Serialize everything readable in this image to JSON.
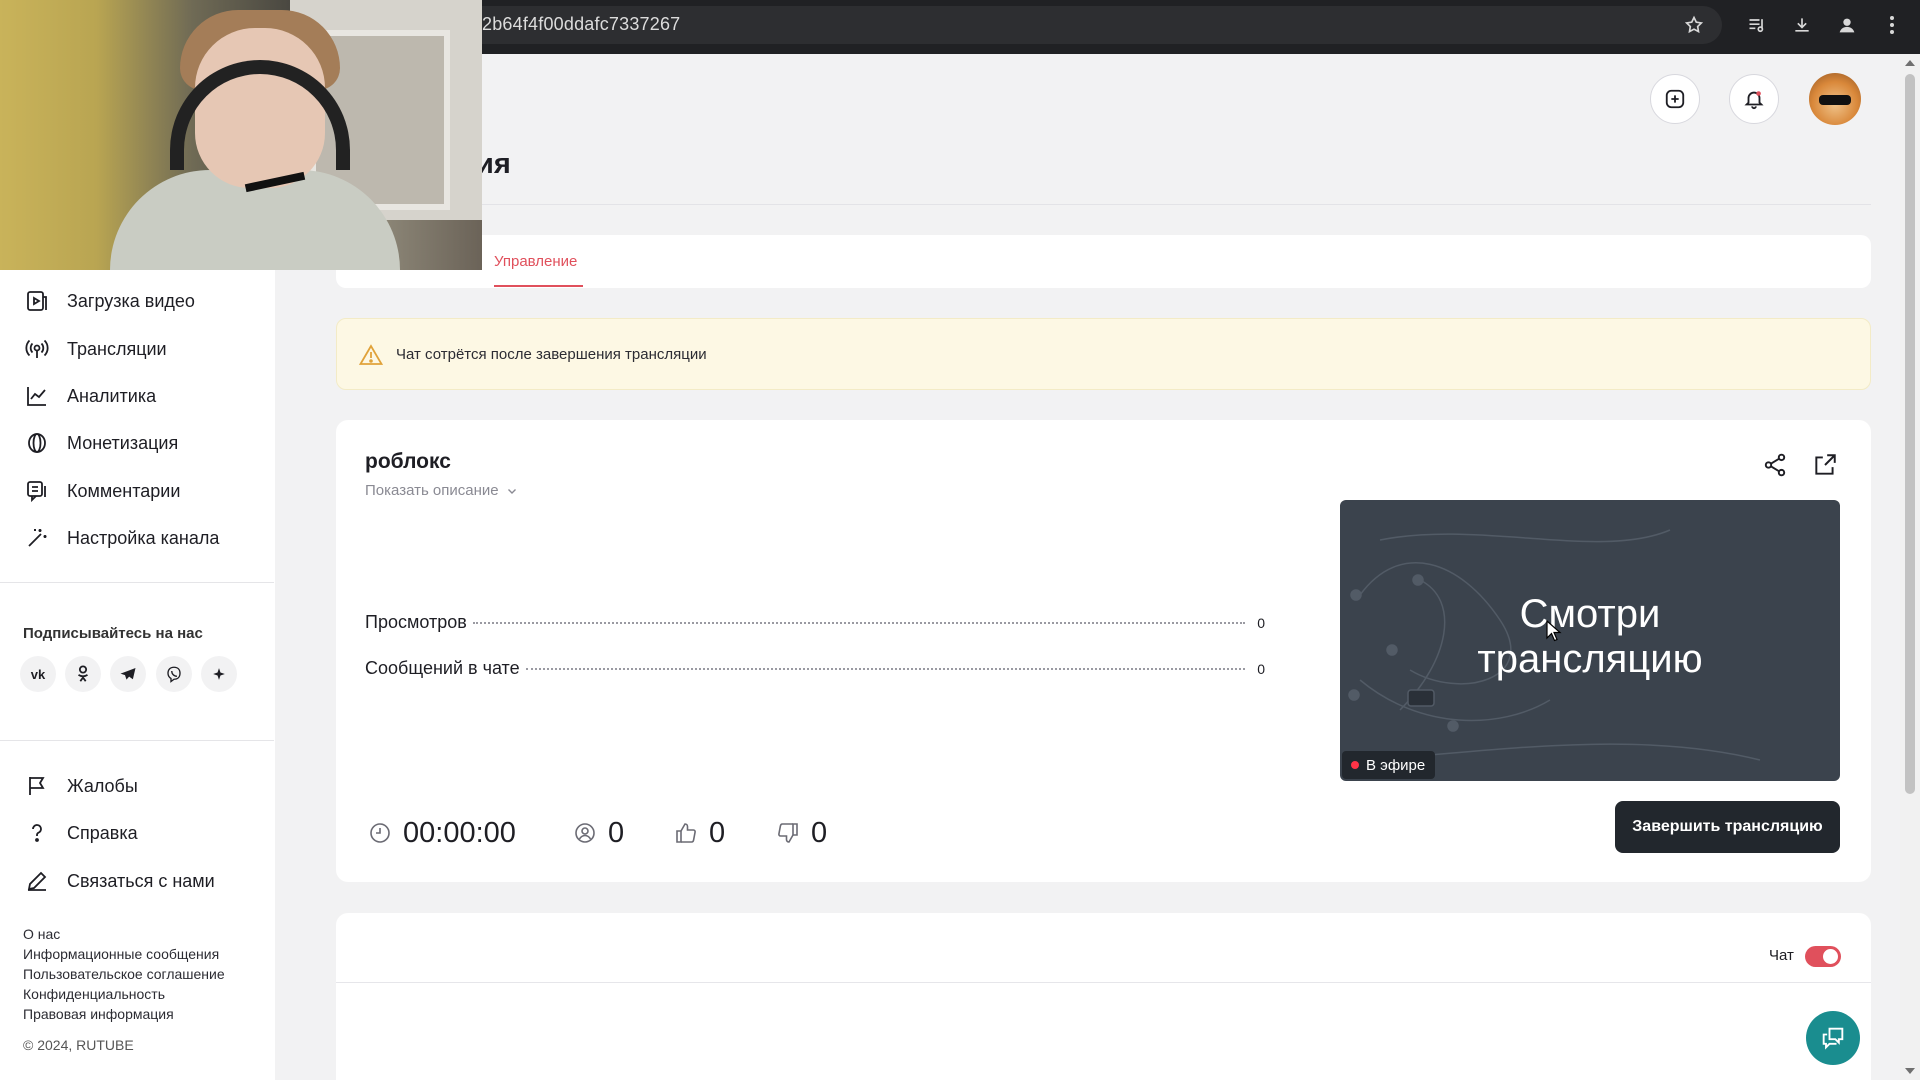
{
  "browser": {
    "url_fragment": "2b64f4f00ddafc7337267"
  },
  "header": {
    "page_title_visible": "ия"
  },
  "tabs": {
    "active": "Управление"
  },
  "sidebar": {
    "items": [
      {
        "label": "Загрузка видео",
        "icon": "video-upload-icon"
      },
      {
        "label": "Трансляции",
        "icon": "broadcast-icon"
      },
      {
        "label": "Аналитика",
        "icon": "analytics-icon"
      },
      {
        "label": "Монетизация",
        "icon": "coin-icon"
      },
      {
        "label": "Комментарии",
        "icon": "comments-icon"
      },
      {
        "label": "Настройка канала",
        "icon": "magic-wand-icon"
      }
    ],
    "follow_title": "Подписывайтесь на нас",
    "socials": [
      "vk-icon",
      "odnoklassniki-icon",
      "telegram-icon",
      "viber-icon",
      "sparkle-icon"
    ],
    "bottom_items": [
      {
        "label": "Жалобы",
        "icon": "flag-icon"
      },
      {
        "label": "Справка",
        "icon": "help-icon"
      },
      {
        "label": "Связаться с нами",
        "icon": "edit-icon"
      }
    ],
    "footer_links": [
      "О нас",
      "Информационные сообщения",
      "Пользовательское соглашение",
      "Конфиденциальность",
      "Правовая информация"
    ],
    "copyright": "© 2024, RUTUBE"
  },
  "alert": {
    "text": "Чат сотрётся после завершения трансляции"
  },
  "stream": {
    "title": "роблокс",
    "show_description": "Показать описание",
    "stats": [
      {
        "label": "Просмотров",
        "value": "0"
      },
      {
        "label": "Сообщений в чате",
        "value": "0"
      }
    ],
    "preview_text_line1": "Смотри",
    "preview_text_line2": "трансляцию",
    "live_badge": "В эфире",
    "duration": "00:00:00",
    "viewers": "0",
    "likes": "0",
    "dislikes": "0",
    "end_button": "Завершить трансляцию"
  },
  "chat": {
    "label": "Чат",
    "enabled": true
  },
  "colors": {
    "accent": "#e0505c",
    "dark_button": "#22272d",
    "support": "#1a8d8f",
    "alert_bg": "#fdf8e4"
  }
}
